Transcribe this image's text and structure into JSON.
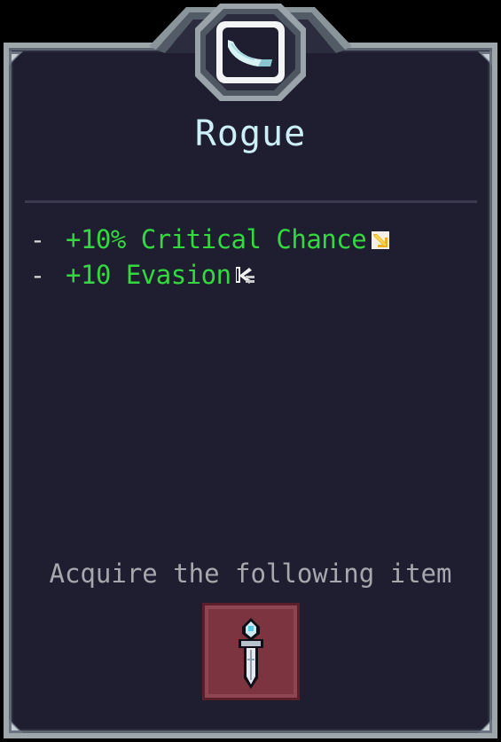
{
  "card": {
    "class_name": "Rogue",
    "crest_icon": "dagger-blade-icon",
    "stats": [
      {
        "prefix": "-",
        "text": "+10% Critical Chance",
        "icon": "critical-chance-icon"
      },
      {
        "prefix": "-",
        "text": "+10 Evasion",
        "icon": "evasion-icon"
      }
    ],
    "acquire_text": "Acquire the following item",
    "item_icon": "dagger-item-icon"
  },
  "colors": {
    "background": "#1f1e31",
    "frame": "#9da6ab",
    "title": "#cdeff7",
    "stat_text": "#33d93e",
    "muted_text": "#a8a7ae",
    "item_slot": "#7c3440"
  }
}
